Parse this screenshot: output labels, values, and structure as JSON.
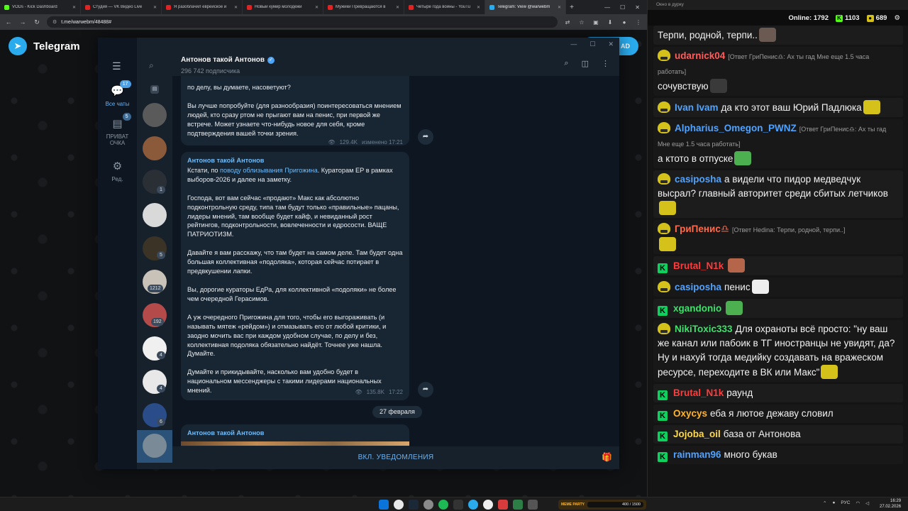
{
  "browser": {
    "tabs": [
      {
        "title": "VODs - Kick Dashboard",
        "color": "#53fc18",
        "active": false
      },
      {
        "title": "Студия — VK Видео Live",
        "color": "#e02424",
        "active": false
      },
      {
        "title": "Я разоблачил еврейское и",
        "color": "#e02424",
        "active": false
      },
      {
        "title": "Новый кумир молодежи",
        "color": "#e02424",
        "active": false
      },
      {
        "title": "Мужики Превращаются в",
        "color": "#e02424",
        "active": false
      },
      {
        "title": "Четыре года войны - YouTu",
        "color": "#e02424",
        "active": false
      },
      {
        "title": "Telegram: View @warwebm",
        "color": "#2aabee",
        "active": true
      }
    ],
    "url": "t.me/warwebm/48488#"
  },
  "tgweb": {
    "logo": "Telegram",
    "open_btn": "AD"
  },
  "telegram": {
    "folders": [
      {
        "label": "Все чаты",
        "badge": "17",
        "icon": "💬",
        "active": true
      },
      {
        "label": "ПРИВАТ ОЧКА",
        "badge": "5",
        "icon": "👥",
        "active": false
      },
      {
        "label": "Ред.",
        "badge": "",
        "icon": "⚙",
        "active": false
      }
    ],
    "chat_badges": [
      "1",
      "5",
      "1212",
      "192",
      "4",
      "4",
      "6"
    ],
    "chat": {
      "title": "Антонов такой Антонов",
      "subscribers": "296 742 подписчика"
    },
    "msg1": {
      "top_text": "по делу, вы думаете, насоветуют?",
      "text": "Вы лучше попробуйте (для разнообразия) поинтересоваться мнением людей, кто сразу ртом не прыгают вам на пенис, при первой же встрече. Может узнаете что-нибудь новое для себя, кроме подтверждения вашей точки зрения.",
      "views": "129.4K",
      "time": "изменено 17:21"
    },
    "msg2": {
      "author": "Антонов такой Антонов",
      "p1_pre": "Кстати, по ",
      "p1_link": "поводу облизывания Пригожина",
      "p1_post": ". Кураторам ЕР в рамках выборов-2026 и далее на заметку.",
      "p2": "Господа, вот вам сейчас «продают» Макс как абсолютно подконтрольную среду, типа там будут только «правильные» пацаны, лидеры мнений, там вообще будет кайф, и невиданный рост рейтингов, подконтрольности, вовлеченности и едросости. ВАЩЕ ПАТРИОТИЗМ.",
      "p3": "Давайте я вам расскажу, что там будет на самом деле. Там будет одна большая коллективная «подоляка», которая сейчас потирает в предвкушении лапки.",
      "p4": "Вы, дорогие кураторы ЕдРа, для коллективной «подоляки» не более чем очередной Герасимов.",
      "p5": "А уж очередного Пригожина для того, чтобы его выгораживать (и называть мятеж «рейдом») и отмазывать его от любой критики, и заодно мочить вас при каждом удобном случае, по делу и без, коллективная подоляка обязательно найдёт. Точнее уже нашла. Думайте.",
      "p6": "Думайте и прикидывайте, насколько вам удобно будет в национальном мессенджеры с такими лидерами национальных мнений.",
      "views": "135.8K",
      "time": "17:22"
    },
    "date_pill": "27 февраля",
    "msg3_author": "Антонов такой Антонов",
    "notify_btn": "ВКЛ. УВЕДОМЛЕНИЯ"
  },
  "stream": {
    "window_title": "Окно в дурку",
    "online_label": "Online:",
    "online": "1792",
    "kick_count": "1103",
    "other_count": "689",
    "messages": [
      {
        "user": "",
        "color": "#ffffff",
        "badge": "",
        "reply": "",
        "text": "Терпи, родной, терпи..",
        "emote": "#6b5a52"
      },
      {
        "user": "udarnick04",
        "color": "#ff5c5c",
        "badge": "face",
        "reply": "[Ответ ГриПенис♎: Ах ты гад Мне еще 1.5 часа работать]",
        "text": "сочувствую",
        "emote": "#3a3a3a"
      },
      {
        "user": "Ivan Ivam",
        "color": "#4fa3ff",
        "badge": "face",
        "reply": "",
        "text": "да кто этот ваш Юрий Падлюка",
        "emote": "#d4c21b"
      },
      {
        "user": "Alpharius_Omegon_PWNZ",
        "color": "#4fa3ff",
        "badge": "face",
        "reply": "[Ответ ГриПенис♎: Ах ты гад Мне еще 1.5 часа работать]",
        "text": "а ктото в отпуске",
        "emote": "#4caf50"
      },
      {
        "user": "casiposha",
        "color": "#4fa3ff",
        "badge": "face",
        "reply": "",
        "text": "а видели что пидор медведчук высрал? главный авторитет среди сбитых летчиков",
        "emote": "#d4c21b"
      },
      {
        "user": "ГриПенис♎",
        "color": "#ff6b4a",
        "badge": "face",
        "reply": "[Ответ Hedina: Терпи, родной, терпи..]",
        "text": "",
        "emote": "#d4c21b"
      },
      {
        "user": "Brutal_N1k",
        "color": "#ff3b3b",
        "badge": "k",
        "reply": "",
        "text": "",
        "emote": "#b5654a"
      },
      {
        "user": "casiposha",
        "color": "#4fa3ff",
        "badge": "face",
        "reply": "",
        "text": "пенис",
        "emote": "#eeeeee"
      },
      {
        "user": "xgandonio",
        "color": "#3fe06b",
        "badge": "k",
        "reply": "",
        "text": "",
        "emote": "#4caf50"
      },
      {
        "user": "NikiToxic333",
        "color": "#3fe06b",
        "badge": "face",
        "reply": "",
        "text": "Для охраноты всё просто: \"ну ваш же канал или пабоик в ТГ иностранцы не увидят, да? Ну и нахуй тогда медийку создавать на вражеском ресурсе, переходите в ВК или Макс\"",
        "emote": "#d4c21b"
      },
      {
        "user": "Brutal_N1k",
        "color": "#ff3b3b",
        "badge": "k",
        "reply": "",
        "text": "раунд",
        "emote": ""
      },
      {
        "user": "Oxycys",
        "color": "#ffb52e",
        "badge": "k",
        "reply": "",
        "text": "еба я лютое дежаву словил",
        "emote": ""
      },
      {
        "user": "Jojoba_oil",
        "color": "#ffd84a",
        "badge": "k",
        "reply": "",
        "text": "база от Антонова",
        "emote": ""
      },
      {
        "user": "rainman96",
        "color": "#4fa3ff",
        "badge": "k",
        "reply": "",
        "text": "много букав",
        "emote": ""
      }
    ]
  },
  "taskbar": {
    "meme_label": "MEME PARTY",
    "meme_progress": "400 / 1500",
    "lang": "РУС",
    "time": "16:29",
    "date": "27.02.2026"
  }
}
